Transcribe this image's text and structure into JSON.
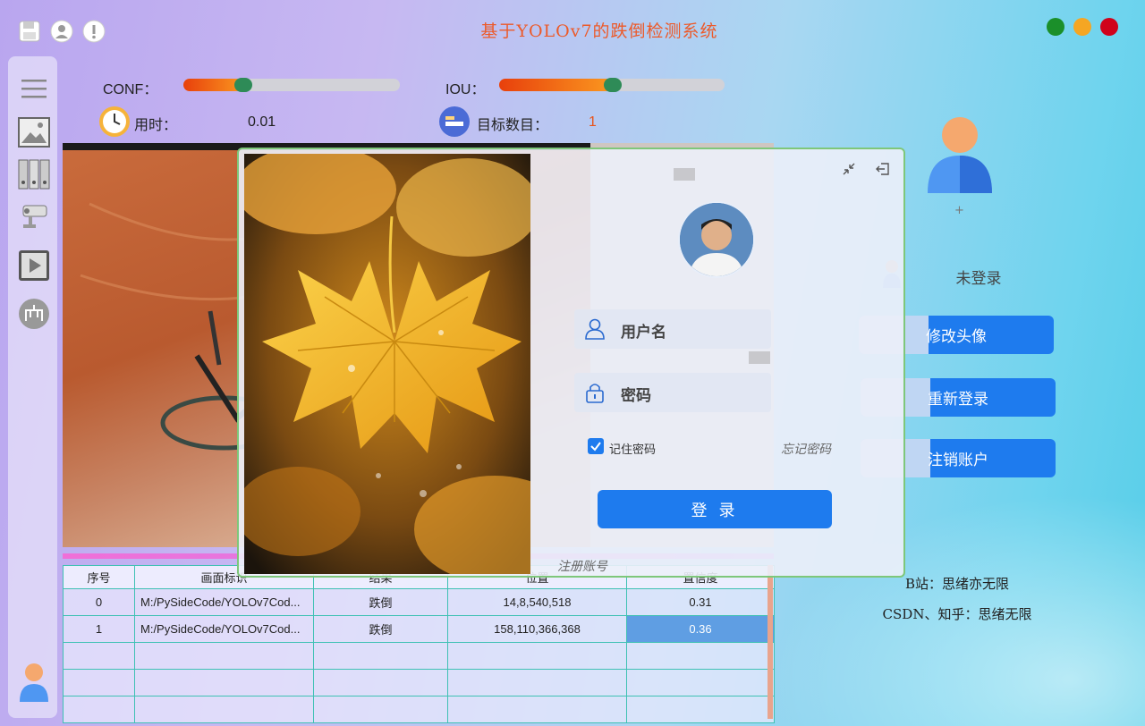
{
  "app": {
    "title": "基于YOLOv7的跌倒检测系统"
  },
  "toolbar": {
    "icons": [
      "save-icon",
      "user-icon",
      "warning-icon"
    ]
  },
  "window_controls": {
    "colors": [
      "#1b8f2a",
      "#f5a623",
      "#d0021b"
    ]
  },
  "sidebar": {
    "items": [
      "menu-icon",
      "image-icon",
      "folder-icon",
      "camera-icon",
      "video-icon",
      "model-icon"
    ],
    "bottom": "user-icon"
  },
  "params": {
    "conf_label": "CONF：",
    "conf_value": 0.27,
    "iou_label": "IOU：",
    "iou_value": 0.5,
    "time_label": "用时：",
    "time_value": "0.01",
    "count_label": "目标数目：",
    "count_value": "1"
  },
  "table": {
    "headers": [
      "序号",
      "画面标识",
      "结果",
      "位置",
      "置信度"
    ],
    "rows": [
      [
        "0",
        "M:/PySideCode/YOLOv7Cod...",
        "跌倒",
        "14,8,540,518",
        "0.31"
      ],
      [
        "1",
        "M:/PySideCode/YOLOv7Cod...",
        "跌倒",
        "158,110,366,368",
        "0.36"
      ]
    ]
  },
  "user_panel": {
    "plus": "+",
    "status": "未登录",
    "buttons": [
      "修改头像",
      "重新登录",
      "注销账户"
    ],
    "credit_1": "B站：思绪亦无限",
    "credit_2": "CSDN、知乎：思绪无限"
  },
  "login": {
    "username_placeholder": "用户名",
    "password_placeholder": "密码",
    "remember_label": "记住密码",
    "forgot_label": "忘记密码",
    "login_button": "登 录",
    "register_label": "注册账号",
    "accent": "#1e7bee"
  }
}
